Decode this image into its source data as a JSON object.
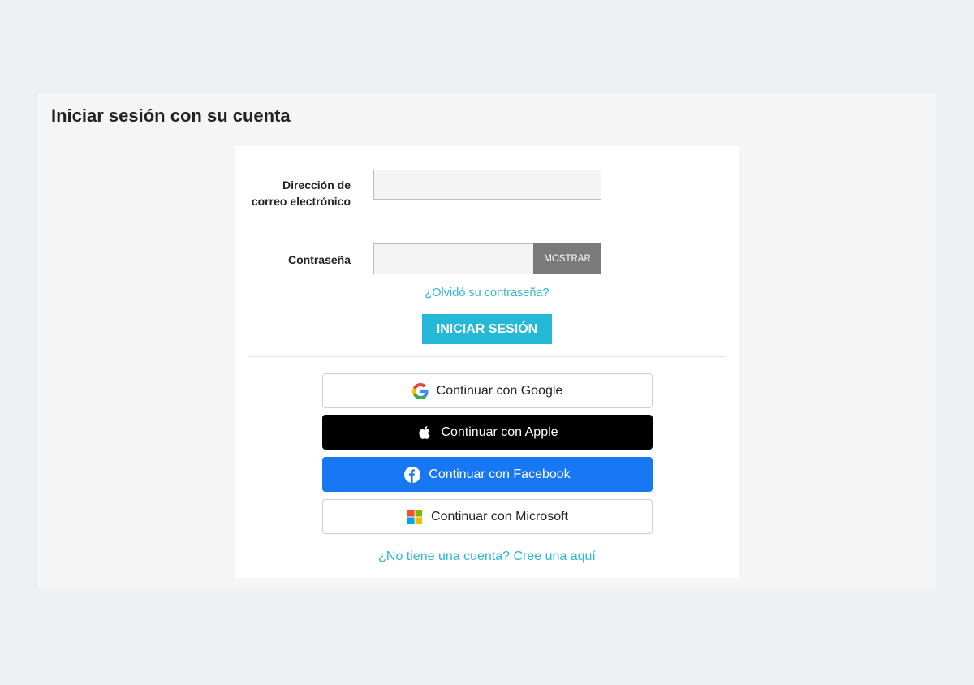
{
  "page": {
    "title": "Iniciar sesión con su cuenta"
  },
  "form": {
    "email_label": "Dirección de correo electrónico",
    "email_value": "",
    "password_label": "Contraseña",
    "password_value": "",
    "show_button": "MOSTRAR",
    "forgot_link": "¿Olvidó su contraseña?",
    "signin_button": "INICIAR SESIÓN"
  },
  "social": {
    "google": {
      "label": "Continuar con Google",
      "icon": "google-icon"
    },
    "apple": {
      "label": "Continuar con Apple",
      "icon": "apple-icon",
      "color": "#000000"
    },
    "facebook": {
      "label": "Continuar con Facebook",
      "icon": "facebook-icon",
      "color": "#1877f2"
    },
    "microsoft": {
      "label": "Continuar con Microsoft",
      "icon": "microsoft-icon"
    }
  },
  "register_link": "¿No tiene una cuenta? Cree una aquí",
  "colors": {
    "accent": "#24b9d7",
    "link": "#2fb5d2",
    "background": "#edf0f3",
    "panel": "#f5f5f5"
  }
}
